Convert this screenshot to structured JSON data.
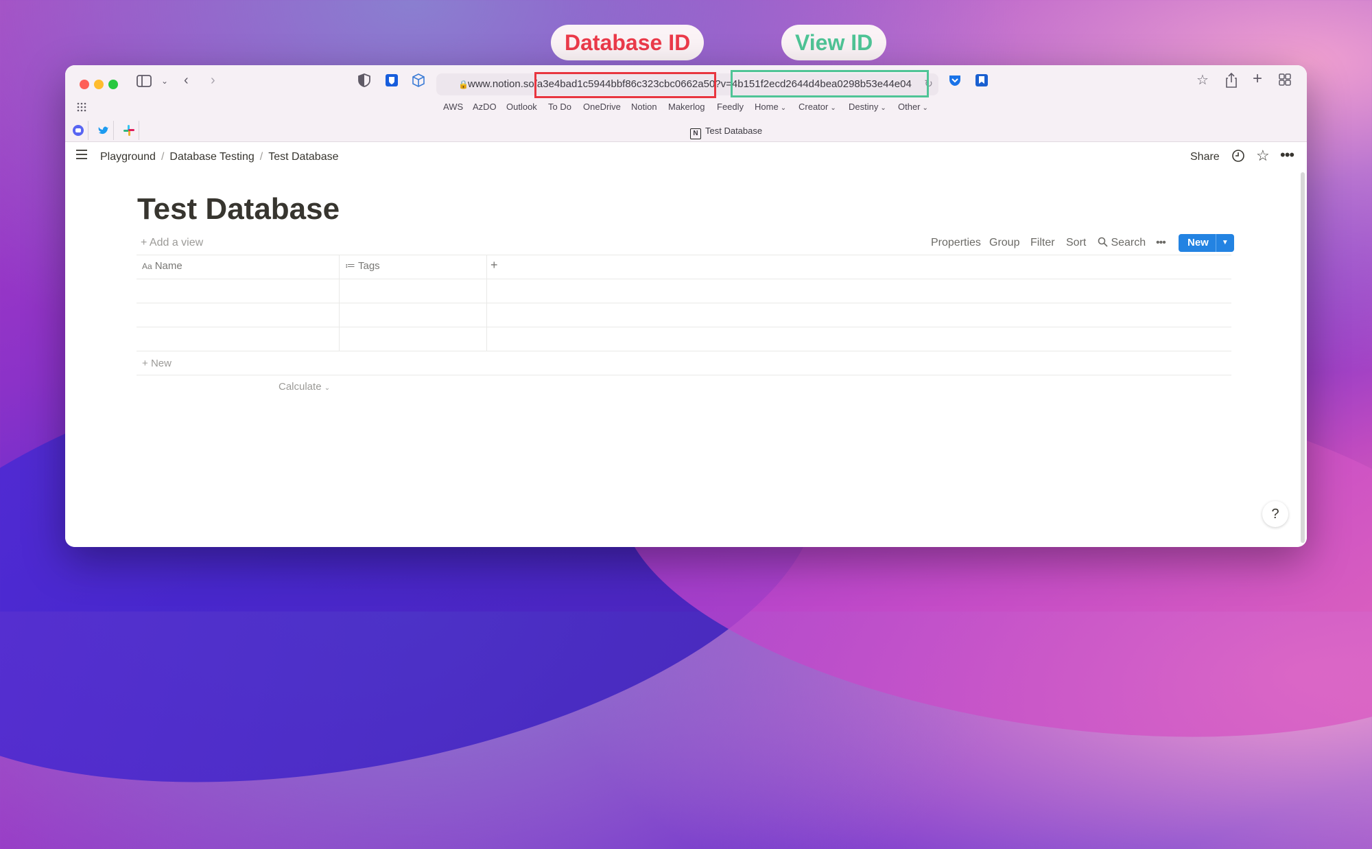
{
  "annotations": {
    "database_label": "Database ID",
    "view_label": "View ID"
  },
  "browser": {
    "url": "www.notion.so/a3e4bad1c5944bbf86c323cbc0662a50?v=4b151f2ecd2644d4bea0298b53e44e04",
    "favorites": [
      "AWS",
      "AzDO",
      "Outlook",
      "To Do",
      "OneDrive",
      "Notion",
      "Makerlog",
      "Feedly"
    ],
    "folders": [
      "Home",
      "Creator",
      "Destiny",
      "Other"
    ],
    "tab_title": "Test Database",
    "tab_logo": "N"
  },
  "breadcrumb": [
    "Playground",
    "Database Testing",
    "Test Database"
  ],
  "topbar": {
    "share": "Share"
  },
  "page": {
    "title": "Test Database"
  },
  "toolbar": {
    "add_view": "Add a view",
    "properties": "Properties",
    "group": "Group",
    "filter": "Filter",
    "sort": "Sort",
    "search": "Search",
    "new": "New"
  },
  "table": {
    "columns": [
      {
        "icon": "Aa",
        "label": "Name"
      },
      {
        "icon": "≔",
        "label": "Tags"
      }
    ],
    "empty_rows": 3,
    "new_row": "New",
    "calculate": "Calculate"
  },
  "help": "?"
}
